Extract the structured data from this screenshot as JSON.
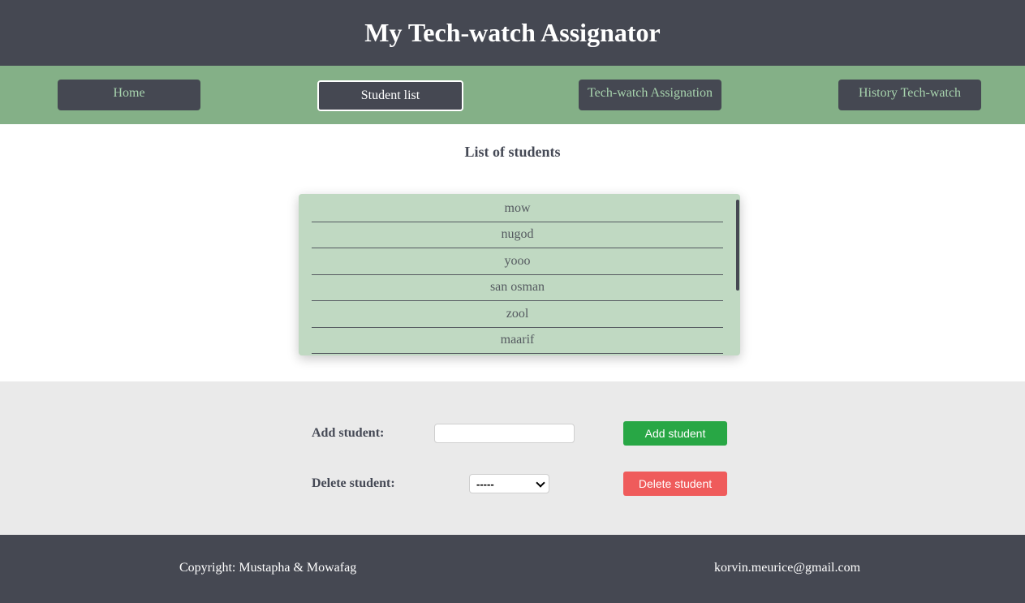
{
  "header": {
    "title": "My Tech-watch Assignator"
  },
  "nav": {
    "home": "Home",
    "student_list": "Student list",
    "assignation": "Tech-watch Assignation",
    "history": "History Tech-watch",
    "active": "Student list"
  },
  "students": {
    "title": "List of students",
    "items": [
      "mow",
      "nugod",
      "yooo",
      "san osman",
      "zool",
      "maarif"
    ]
  },
  "form": {
    "add_label": "Add student:",
    "add_value": "",
    "add_button": "Add student",
    "delete_label": "Delete student:",
    "delete_selected": "-----",
    "delete_button": "Delete student"
  },
  "footer": {
    "copyright": "Copyright: Mustapha & Mowafag",
    "email": "korvin.meurice@gmail.com"
  },
  "colors": {
    "header_bg": "#454852",
    "nav_bg": "#84b087",
    "list_bg": "#c0d9c2",
    "add_button": "#28a745",
    "delete_button": "#ef5b5b"
  }
}
